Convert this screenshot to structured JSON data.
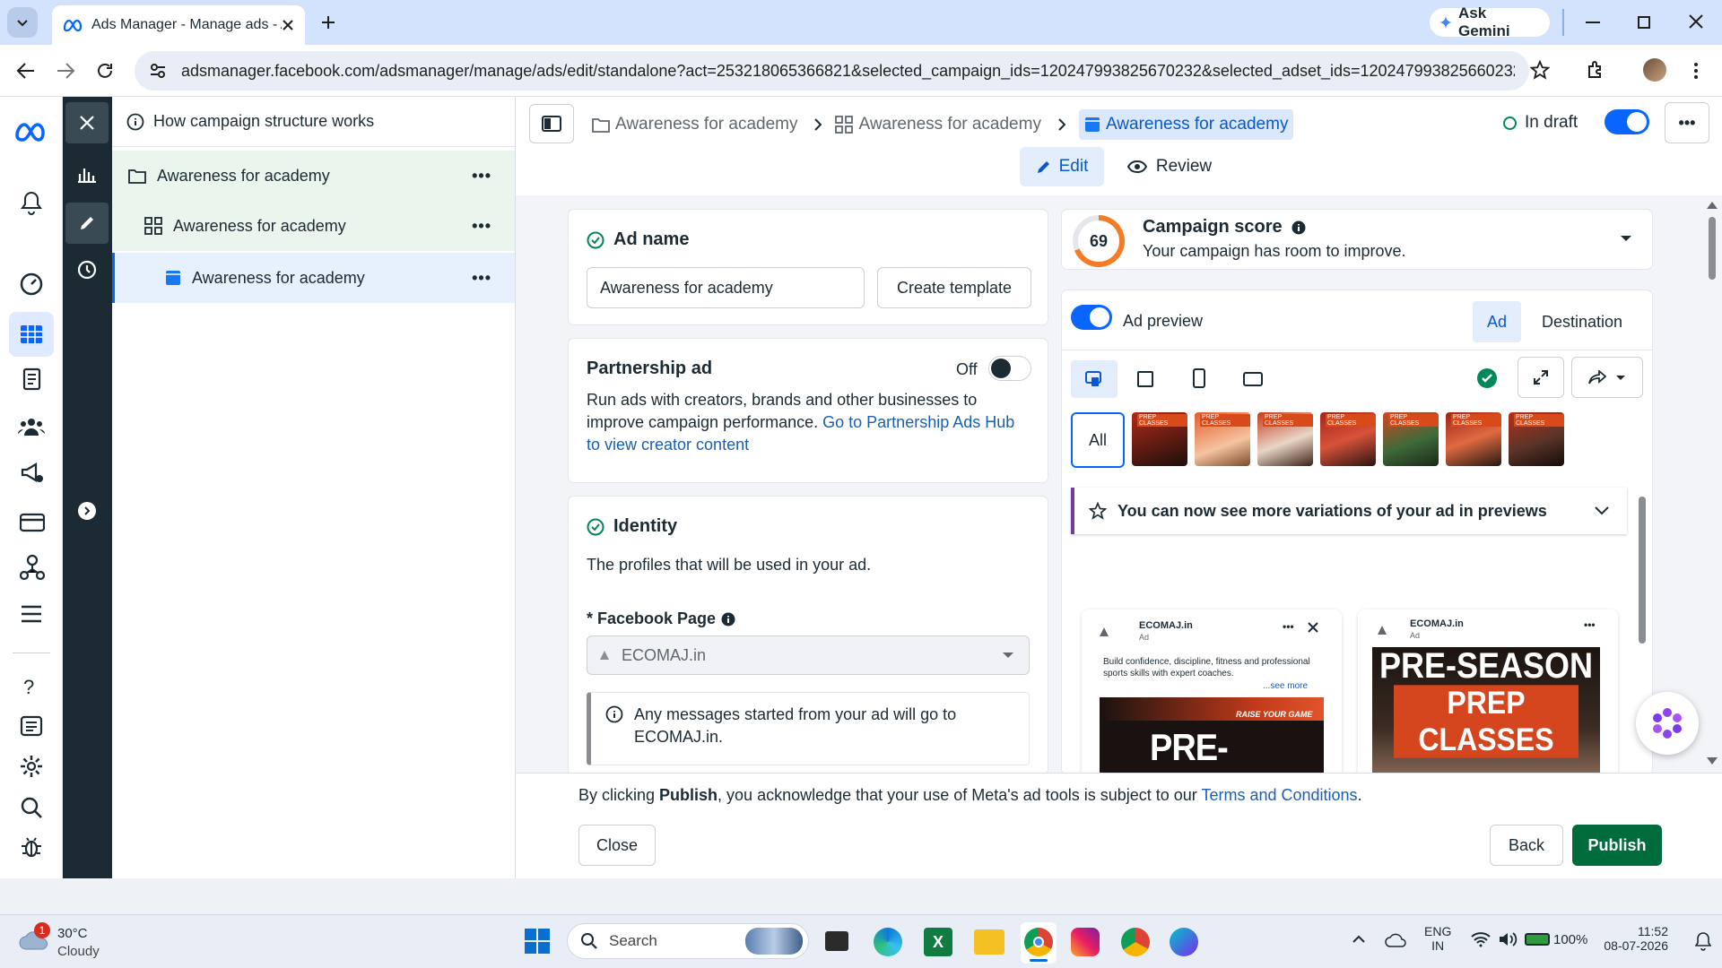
{
  "browser": {
    "tab_title": "Ads Manager - Manage ads - A",
    "url": "adsmanager.facebook.com/adsmanager/manage/ads/edit/standalone?act=253218065366821&selected_campaign_ids=120247993825670232&selected_adset_ids=120247993825660232&sele...",
    "gemini_label": "Ask Gemini"
  },
  "tree": {
    "header": "How campaign structure works",
    "campaign": "Awareness for academy",
    "adset": "Awareness for academy",
    "ad": "Awareness for academy"
  },
  "topbar": {
    "crumb_campaign": "Awareness for academy",
    "crumb_adset": "Awareness for academy",
    "crumb_ad": "Awareness for academy",
    "status": "In draft",
    "edit_label": "Edit",
    "review_label": "Review"
  },
  "ad_name": {
    "heading": "Ad name",
    "value": "Awareness for academy",
    "template_button": "Create template"
  },
  "partnership": {
    "heading": "Partnership ad",
    "toggle_label": "Off",
    "description": "Run ads with creators, brands and other businesses to improve campaign performance.",
    "link": "Go to Partnership Ads Hub to view creator content"
  },
  "identity": {
    "heading": "Identity",
    "description": "The profiles that will be used in your ad.",
    "page_label": "* Facebook Page",
    "page_value": "ECOMAJ.in",
    "info_text": "Any messages started from your ad will go to ECOMAJ.in."
  },
  "score": {
    "value": "69",
    "heading": "Campaign score",
    "subtitle": "Your campaign has room to improve."
  },
  "preview": {
    "label": "Ad preview",
    "tab_ad": "Ad",
    "tab_destination": "Destination",
    "all_label": "All",
    "banner": "You can now see more variations of your ad in previews",
    "thumb_caption": "PREP CLASSES",
    "card1": {
      "page": "ECOMAJ.in",
      "sub": "Ad",
      "body": "Build confidence, discipline, fitness and professional sports skills with expert coaches.",
      "see_more": "...see more",
      "tagline": "RAISE YOUR GAME",
      "headline": "PRE-SEASON"
    },
    "card2": {
      "page": "ECOMAJ.in",
      "sub": "Ad",
      "headline1": "PRE-SEASON",
      "headline2": "PREP CLASSES"
    }
  },
  "footer": {
    "text_before": "By clicking ",
    "text_bold": "Publish",
    "text_after": ", you acknowledge that your use of Meta's ad tools is subject to our ",
    "link": "Terms and Conditions",
    "period": ".",
    "close": "Close",
    "back": "Back",
    "publish": "Publish"
  },
  "taskbar": {
    "temp": "30°C",
    "weather": "Cloudy",
    "weather_badge": "1",
    "search": "Search",
    "lang1": "ENG",
    "lang2": "IN",
    "battery": "100%",
    "time": "11:52",
    "date": "08-07-2026"
  },
  "colors": {
    "meta_blue": "#0866ff",
    "dark_rail": "#1c2b33",
    "publish_green": "#006b3c",
    "link_blue": "#1a5fb4"
  }
}
